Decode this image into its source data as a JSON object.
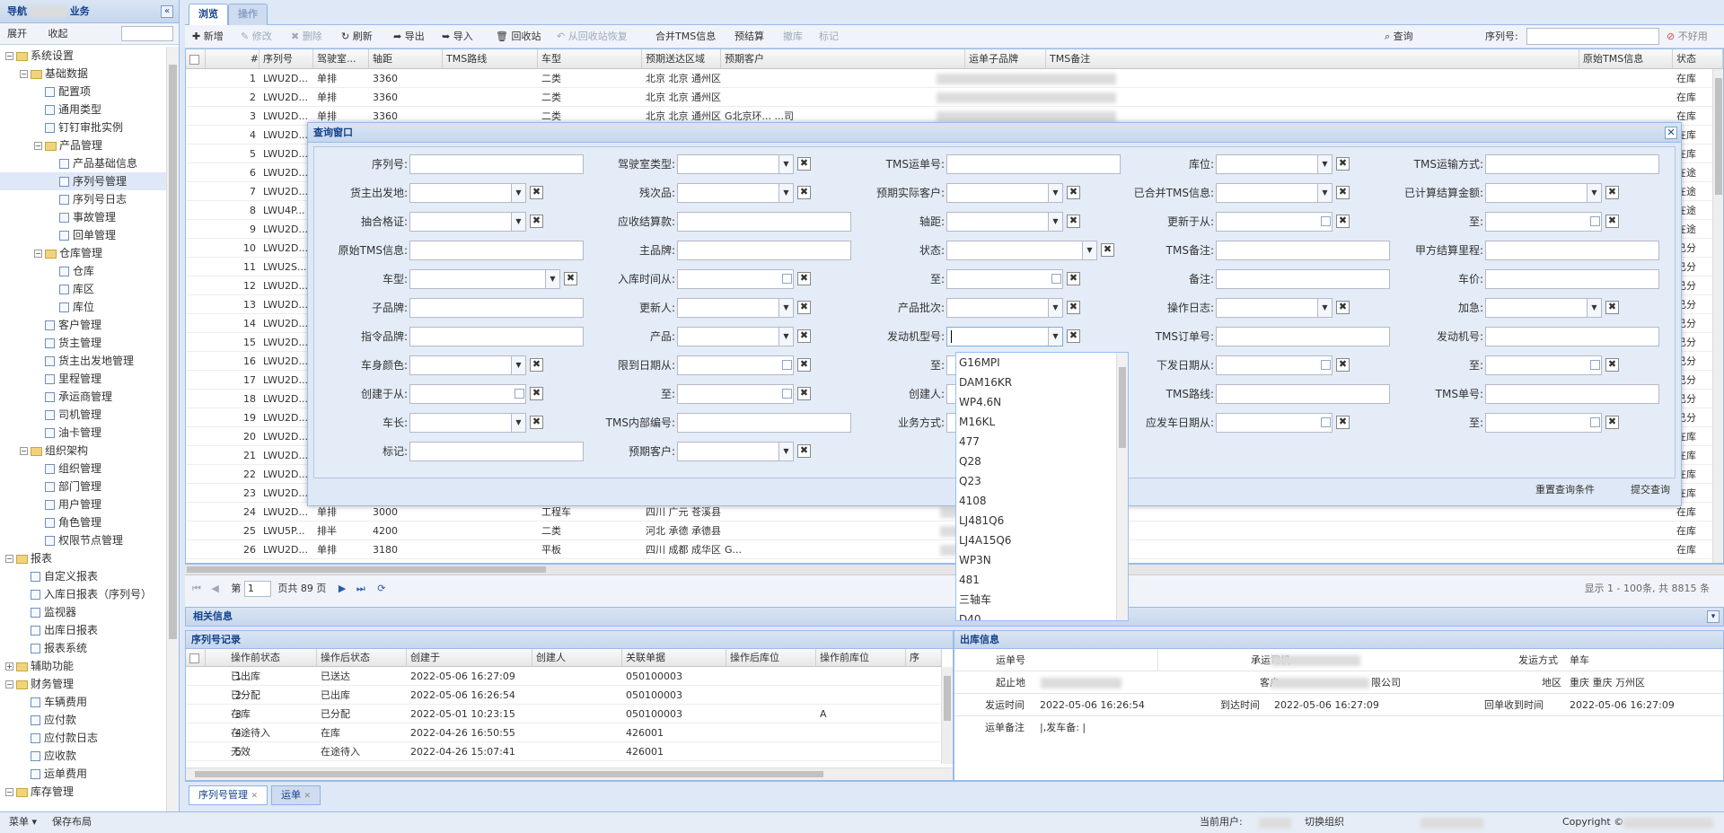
{
  "nav": {
    "title": "导航",
    "title_suffix": "业务",
    "expand": "展开",
    "collapse": "收起",
    "tree": [
      {
        "label": "系统设置",
        "lvl": 0,
        "type": "folder",
        "open": true
      },
      {
        "label": "基础数据",
        "lvl": 1,
        "type": "folder",
        "open": true
      },
      {
        "label": "配置项",
        "lvl": 2,
        "type": "leaf"
      },
      {
        "label": "通用类型",
        "lvl": 2,
        "type": "leaf"
      },
      {
        "label": "钉钉审批实例",
        "lvl": 2,
        "type": "leaf"
      },
      {
        "label": "产品管理",
        "lvl": 2,
        "type": "folder",
        "open": true
      },
      {
        "label": "产品基础信息",
        "lvl": 3,
        "type": "leaf"
      },
      {
        "label": "序列号管理",
        "lvl": 3,
        "type": "leaf",
        "selected": true
      },
      {
        "label": "序列号日志",
        "lvl": 3,
        "type": "leaf"
      },
      {
        "label": "事故管理",
        "lvl": 3,
        "type": "leaf"
      },
      {
        "label": "回单管理",
        "lvl": 3,
        "type": "leaf"
      },
      {
        "label": "仓库管理",
        "lvl": 2,
        "type": "folder",
        "open": true
      },
      {
        "label": "仓库",
        "lvl": 3,
        "type": "leaf"
      },
      {
        "label": "库区",
        "lvl": 3,
        "type": "leaf"
      },
      {
        "label": "库位",
        "lvl": 3,
        "type": "leaf"
      },
      {
        "label": "客户管理",
        "lvl": 2,
        "type": "leaf"
      },
      {
        "label": "货主管理",
        "lvl": 2,
        "type": "leaf"
      },
      {
        "label": "货主出发地管理",
        "lvl": 2,
        "type": "leaf"
      },
      {
        "label": "里程管理",
        "lvl": 2,
        "type": "leaf"
      },
      {
        "label": "承运商管理",
        "lvl": 2,
        "type": "leaf"
      },
      {
        "label": "司机管理",
        "lvl": 2,
        "type": "leaf"
      },
      {
        "label": "油卡管理",
        "lvl": 2,
        "type": "leaf"
      },
      {
        "label": "组织架构",
        "lvl": 1,
        "type": "folder",
        "open": true
      },
      {
        "label": "组织管理",
        "lvl": 2,
        "type": "leaf"
      },
      {
        "label": "部门管理",
        "lvl": 2,
        "type": "leaf"
      },
      {
        "label": "用户管理",
        "lvl": 2,
        "type": "leaf"
      },
      {
        "label": "角色管理",
        "lvl": 2,
        "type": "leaf"
      },
      {
        "label": "权限节点管理",
        "lvl": 2,
        "type": "leaf"
      },
      {
        "label": "报表",
        "lvl": 0,
        "type": "folder",
        "open": true
      },
      {
        "label": "自定义报表",
        "lvl": 1,
        "type": "leaf"
      },
      {
        "label": "入库日报表（序列号）",
        "lvl": 1,
        "type": "leaf"
      },
      {
        "label": "监视器",
        "lvl": 1,
        "type": "leaf"
      },
      {
        "label": "出库日报表",
        "lvl": 1,
        "type": "leaf"
      },
      {
        "label": "报表系统",
        "lvl": 1,
        "type": "leaf"
      },
      {
        "label": "辅助功能",
        "lvl": 0,
        "type": "folder",
        "open": false
      },
      {
        "label": "财务管理",
        "lvl": 0,
        "type": "folder",
        "open": true
      },
      {
        "label": "车辆费用",
        "lvl": 1,
        "type": "leaf"
      },
      {
        "label": "应付款",
        "lvl": 1,
        "type": "leaf"
      },
      {
        "label": "应付款日志",
        "lvl": 1,
        "type": "leaf"
      },
      {
        "label": "应收款",
        "lvl": 1,
        "type": "leaf"
      },
      {
        "label": "运单费用",
        "lvl": 1,
        "type": "leaf"
      },
      {
        "label": "库存管理",
        "lvl": 0,
        "type": "folder",
        "open": true
      }
    ]
  },
  "status": {
    "menu": "菜单 ▾",
    "save_layout": "保存布局",
    "current_user": "当前用户:",
    "switch_org": "切换组织",
    "copyright": "Copyright ©"
  },
  "tabs": {
    "browse": "浏览",
    "operate": "操作"
  },
  "toolbar": {
    "add": "新增",
    "edit": "修改",
    "delete": "删除",
    "refresh": "刷新",
    "export": "导出",
    "import": "导入",
    "recycle": "回收站",
    "restore": "从回收站恢复",
    "merge_tms": "合并TMS信息",
    "pre_settle": "预结算",
    "unsettle": "撤库",
    "mark": "标记",
    "query": "查询",
    "serial_label": "序列号:",
    "disable": "不好用"
  },
  "grid": {
    "columns": [
      "#",
      "序列号",
      "驾驶室...",
      "轴距",
      "TMS路线",
      "车型",
      "预期送达区域",
      "预期客户",
      "运单子品牌",
      "TMS备注",
      "原始TMS信息",
      "状态"
    ],
    "rows": [
      [
        "1",
        "LWU2D...",
        "单排",
        "3360",
        "",
        "二类",
        "北京 北京 通州区",
        "",
        "在库"
      ],
      [
        "2",
        "LWU2D...",
        "单排",
        "3360",
        "",
        "二类",
        "北京 北京 通州区",
        "",
        "在库"
      ],
      [
        "3",
        "LWU2D...",
        "单排",
        "3360",
        "",
        "二类",
        "北京 北京 通州区",
        "G北京环... ...司",
        "在库"
      ],
      [
        "4",
        "LWU2D...",
        "",
        "",
        "",
        "",
        "",
        "",
        "在库"
      ],
      [
        "5",
        "LWU2D...",
        "",
        "",
        "",
        "",
        "",
        "",
        "在库"
      ],
      [
        "6",
        "LWU2D...",
        "",
        "",
        "",
        "",
        "",
        "",
        "在途"
      ],
      [
        "7",
        "LWU2D...",
        "",
        "",
        "",
        "",
        "",
        "",
        "在途"
      ],
      [
        "8",
        "LWU4P...",
        "",
        "",
        "",
        "",
        "",
        "",
        "在途"
      ],
      [
        "9",
        "LWU2D...",
        "",
        "",
        "",
        "",
        "",
        "",
        "在途"
      ],
      [
        "10",
        "LWU2D...",
        "",
        "",
        "",
        "",
        "",
        "",
        "已分"
      ],
      [
        "11",
        "LWU2S...",
        "",
        "",
        "",
        "",
        "",
        "",
        "已分"
      ],
      [
        "12",
        "LWU2D...",
        "",
        "",
        "",
        "",
        "",
        "",
        "已分"
      ],
      [
        "13",
        "LWU2D...",
        "",
        "",
        "",
        "",
        "",
        "",
        "已分"
      ],
      [
        "14",
        "LWU2D...",
        "",
        "",
        "",
        "",
        "",
        "",
        "已分"
      ],
      [
        "15",
        "LWU2D...",
        "",
        "",
        "",
        "",
        "",
        "",
        "已分"
      ],
      [
        "16",
        "LWU2D...",
        "",
        "",
        "",
        "",
        "",
        "",
        "已分"
      ],
      [
        "17",
        "LWU2D...",
        "",
        "",
        "",
        "",
        "",
        "",
        "已分"
      ],
      [
        "18",
        "LWU2D...",
        "",
        "",
        "",
        "",
        "",
        "",
        "已分"
      ],
      [
        "19",
        "LWU2D...",
        "",
        "",
        "",
        "",
        "",
        "",
        "已分"
      ],
      [
        "20",
        "LWU2D...",
        "",
        "",
        "",
        "",
        "",
        "",
        "在库"
      ],
      [
        "21",
        "LWU2D...",
        "",
        "",
        "",
        "",
        "",
        "",
        "在库"
      ],
      [
        "22",
        "LWU2D...",
        "",
        "",
        "",
        "",
        "",
        "",
        "在库"
      ],
      [
        "23",
        "LWU2D...",
        "",
        "",
        "",
        "",
        "",
        "",
        "在库"
      ],
      [
        "24",
        "LWU2D...",
        "单排",
        "3000",
        "",
        "工程车",
        "四川 广元 苍溪县",
        "",
        "在库"
      ],
      [
        "25",
        "LWU5P...",
        "排半",
        "4200",
        "",
        "二类",
        "河北 承德 承德县",
        "",
        "在库"
      ],
      [
        "26",
        "LWU2D...",
        "单排",
        "3180",
        "",
        "平板",
        "四川 成都 成华区",
        "G...",
        "在库"
      ]
    ]
  },
  "pager": {
    "page_label": "第",
    "page": "1",
    "total": "页共 89 页",
    "display": "显示 1 - 100条, 共 8815 条"
  },
  "related": "相关信息",
  "serial_rec": {
    "title": "序列号记录",
    "columns": [
      "#",
      "操作前状态",
      "操作后状态",
      "创建于",
      "创建人",
      "关联单据",
      "操作后库位",
      "操作前库位",
      "序"
    ],
    "rows": [
      [
        "1",
        "已出库",
        "已送达",
        "2022-05-06 16:27:09",
        "",
        "050100003",
        "",
        ""
      ],
      [
        "2",
        "已分配",
        "已出库",
        "2022-05-06 16:26:54",
        "",
        "050100003",
        "",
        ""
      ],
      [
        "3",
        "在库",
        "已分配",
        "2022-05-01 10:23:15",
        "",
        "050100003",
        "",
        "A"
      ],
      [
        "4",
        "在途待入",
        "在库",
        "2022-04-26 16:50:55",
        "",
        "426001",
        "",
        ""
      ],
      [
        "5",
        "无效",
        "在途待入",
        "2022-04-26 15:07:41",
        "",
        "426001",
        "",
        ""
      ]
    ]
  },
  "out_info": {
    "title": "出库信息",
    "waybill_label": "运单号",
    "carrier_driver_label": "承运司机",
    "ship_method_label": "发运方式",
    "ship_method": "单车",
    "origin_label": "起止地",
    "customer_label": "客户",
    "customer_suffix": "限公司",
    "region_label": "地区",
    "region": "重庆 重庆 万州区",
    "ship_time_label": "发运时间",
    "ship_time": "2022-05-06 16:26:54",
    "arrive_time_label": "到达时间",
    "arrive_time": "2022-05-06 16:27:09",
    "receipt_time_label": "回单收到时间",
    "receipt_time": "2022-05-06 16:27:09",
    "remark_label": "运单备注",
    "remark": "|,发车备: |"
  },
  "bottom_tabs": [
    "序列号管理",
    "运单"
  ],
  "modal": {
    "title": "查询窗口",
    "reset": "重置查询条件",
    "submit": "提交查询",
    "fields": [
      [
        "序列号:",
        "text"
      ],
      [
        "驾驶室类型:",
        "combo"
      ],
      [
        "TMS运单号:",
        "text"
      ],
      [
        "库位:",
        "combo"
      ],
      [
        "TMS运输方式:",
        "text"
      ],
      [
        "货主出发地:",
        "combo"
      ],
      [
        "残次品:",
        "combo"
      ],
      [
        "预期实际客户:",
        "combo"
      ],
      [
        "已合并TMS信息:",
        "combo"
      ],
      [
        "已计算结算金额:",
        "combo"
      ],
      [
        "抽合格证:",
        "combo"
      ],
      [
        "应收结算款:",
        "text"
      ],
      [
        "轴距:",
        "combo"
      ],
      [
        "更新于从:",
        "date"
      ],
      [
        "至:",
        "date"
      ],
      [
        "原始TMS信息:",
        "text"
      ],
      [
        "主品牌:",
        "text"
      ],
      [
        "状态:",
        "combo"
      ],
      [
        "TMS备注:",
        "text"
      ],
      [
        "甲方结算里程:",
        "text"
      ],
      [
        "车型:",
        "combo"
      ],
      [
        "入库时间从:",
        "date"
      ],
      [
        "至:",
        "date"
      ],
      [
        "备注:",
        "text"
      ],
      [
        "车价:",
        "text"
      ],
      [
        "子品牌:",
        "text"
      ],
      [
        "更新人:",
        "combo"
      ],
      [
        "产品批次:",
        "combo"
      ],
      [
        "操作日志:",
        "combo"
      ],
      [
        "加急:",
        "combo"
      ],
      [
        "指令品牌:",
        "text"
      ],
      [
        "产品:",
        "combo"
      ],
      [
        "发动机型号:",
        "combo"
      ],
      [
        "TMS订单号:",
        "text"
      ],
      [
        "发动机号:",
        "text"
      ],
      [
        "车身颜色:",
        "combo"
      ],
      [
        "限到日期从:",
        "date"
      ],
      [
        "至:",
        "date"
      ],
      [
        "下发日期从:",
        "date"
      ],
      [
        "至:",
        "date"
      ],
      [
        "创建于从:",
        "date"
      ],
      [
        "至:",
        "date"
      ],
      [
        "创建人:",
        "combo"
      ],
      [
        "TMS路线:",
        "text"
      ],
      [
        "TMS单号:",
        "text"
      ],
      [
        "车长:",
        "combo"
      ],
      [
        "TMS内部编号:",
        "text"
      ],
      [
        "业务方式:",
        "combo"
      ],
      [
        "应发车日期从:",
        "date"
      ],
      [
        "至:",
        "date"
      ],
      [
        "标记:",
        "text"
      ],
      [
        "预期客户:",
        "combo"
      ]
    ]
  },
  "engine_options": [
    "G16MPI",
    "DAM16KR",
    "WP4.6N",
    "M16KL",
    "477",
    "Q28",
    "Q23",
    "4108",
    "LJ481Q6",
    "LJ4A15Q6",
    "WP3N",
    "481",
    "三轴车",
    "D40"
  ]
}
